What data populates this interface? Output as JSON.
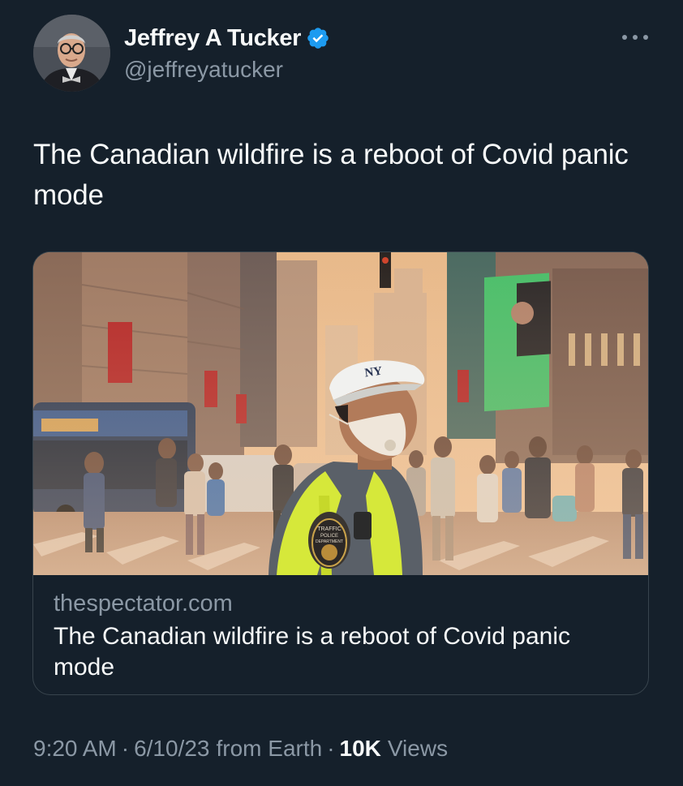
{
  "author": {
    "display_name": "Jeffrey A Tucker",
    "handle": "@jeffreyatucker",
    "verified": true,
    "verified_icon": "verified-badge-icon",
    "verified_color": "#1d9bf0"
  },
  "menu": {
    "more_icon": "more-horizontal-icon"
  },
  "tweet": {
    "text": "The Canadian wildfire is a reboot of Covid panic mode"
  },
  "card": {
    "image_icon": "news-photo",
    "domain": "thespectator.com",
    "title": "The Canadian wildfire is a reboot of Covid panic mode",
    "image_texts": {
      "cap": "NY",
      "patch_line1": "TRAFFIC",
      "patch_line2": "POLICE",
      "patch_line3": "DEPARTMENT"
    }
  },
  "meta": {
    "time": "9:20 AM",
    "separator": "·",
    "date": "6/10/23",
    "source": "from Earth",
    "views_count": "10K",
    "views_label": "Views"
  },
  "colors": {
    "background": "#15202b",
    "text_primary": "#f7f9f9",
    "text_secondary": "#8b98a5",
    "border": "#38444d",
    "accent": "#1d9bf0"
  }
}
